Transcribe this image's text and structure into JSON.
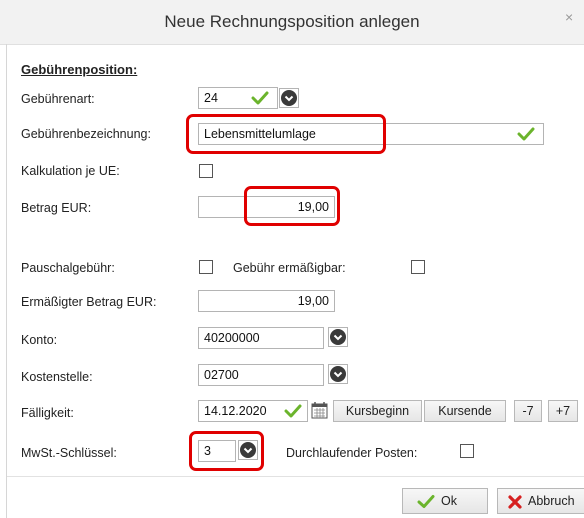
{
  "window": {
    "title": "Neue Rechnungsposition anlegen",
    "close_glyph": "×"
  },
  "section": {
    "title": "Gebührenposition:"
  },
  "fields": {
    "gebuehrenart": {
      "label": "Gebührenart:",
      "value": "24"
    },
    "bezeichnung": {
      "label": "Gebührenbezeichnung:",
      "value": "Lebensmittelumlage"
    },
    "kalkulation": {
      "label": "Kalkulation je UE:"
    },
    "betrag": {
      "label": "Betrag EUR:",
      "value": "19,00"
    },
    "pauschal": {
      "label": "Pauschalgebühr:"
    },
    "ermaessigbar": {
      "label": "Gebühr ermäßigbar:"
    },
    "ermaessigter_betrag": {
      "label": "Ermäßigter Betrag EUR:",
      "value": "19,00"
    },
    "konto": {
      "label": "Konto:",
      "value": "40200000"
    },
    "kostenstelle": {
      "label": "Kostenstelle:",
      "value": "02700"
    },
    "faelligkeit": {
      "label": "Fälligkeit:",
      "value": "14.12.2020"
    },
    "mwst": {
      "label": "MwSt.-Schlüssel:",
      "value": "3"
    },
    "durchlaufend": {
      "label": "Durchlaufender Posten:"
    }
  },
  "date_buttons": {
    "kursbeginn": "Kursbeginn",
    "kursende": "Kursende",
    "minus7": "-7",
    "plus7": "+7"
  },
  "footer": {
    "ok": "Ok",
    "abbruch": "Abbruch"
  },
  "colors": {
    "valid_check": "#6bb42c",
    "highlight": "#e00000",
    "cancel_x": "#d62020"
  }
}
